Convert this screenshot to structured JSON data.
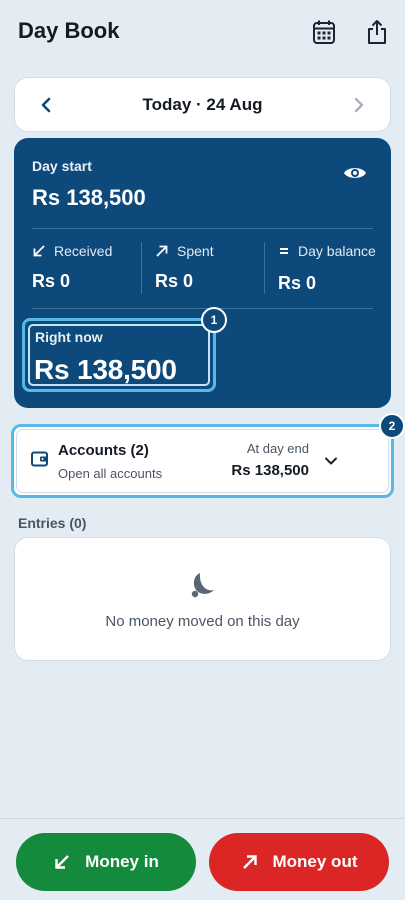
{
  "header": {
    "title": "Day Book",
    "icons": [
      "calendar-icon",
      "share-icon"
    ]
  },
  "date_nav": {
    "label": "Today · 24 Aug"
  },
  "summary": {
    "day_start_label": "Day start",
    "day_start_value": "Rs 138,500",
    "received_label": "Received",
    "received_value": "Rs 0",
    "spent_label": "Spent",
    "spent_value": "Rs 0",
    "day_balance_label": "Day balance",
    "day_balance_value": "Rs 0",
    "right_now_label": "Right now",
    "right_now_value": "Rs 138,500",
    "badge_1": "1"
  },
  "accounts": {
    "title": "Accounts (2)",
    "subtitle": "Open all accounts",
    "end_label": "At day end",
    "end_value": "Rs 138,500",
    "badge_2": "2"
  },
  "entries": {
    "label": "Entries (0)",
    "empty_text": "No money moved on this day"
  },
  "actions": {
    "money_in": "Money in",
    "money_out": "Money out"
  },
  "colors": {
    "primary": "#0d4a7b",
    "highlight": "#59b9e6",
    "money_in": "#138a3c",
    "money_out": "#dc2626",
    "background": "#e3ecf3"
  }
}
